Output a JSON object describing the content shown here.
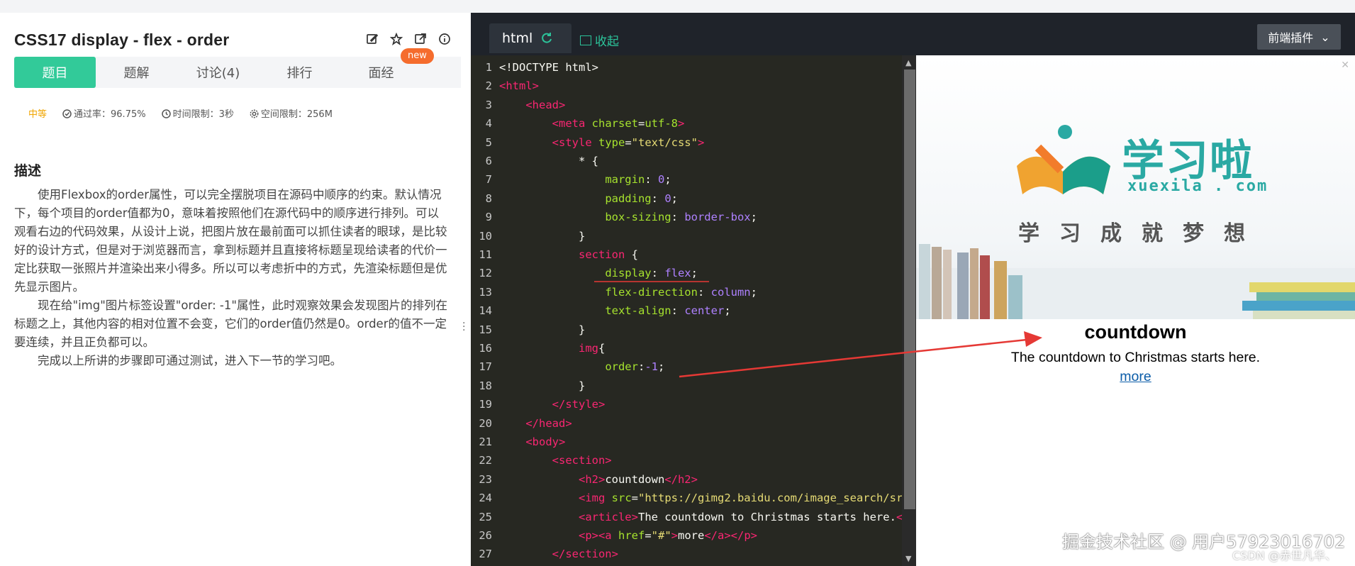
{
  "problem": {
    "title": "CSS17  display - flex - order",
    "tabs": [
      {
        "label": "题目"
      },
      {
        "label": "题解"
      },
      {
        "label": "讨论(4)"
      },
      {
        "label": "排行"
      },
      {
        "label": "面经"
      }
    ],
    "new_badge": "new",
    "meta": {
      "level": "中等",
      "pass_rate": "通过率：96.75%",
      "time_limit": "时间限制：3秒",
      "space_limit": "空间限制：256M"
    },
    "desc_heading": "描述",
    "desc_paragraphs": [
      "使用Flexbox的order属性，可以完全摆脱项目在源码中顺序的约束。默认情况下，每个项目的order值都为0，意味着按照他们在源代码中的顺序进行排列。可以观看右边的代码效果，从设计上说，把图片放在最前面可以抓住读者的眼球，是比较好的设计方式，但是对于浏览器而言，拿到标题并且直接将标题呈现给读者的代价一定比获取一张照片并渲染出来小得多。所以可以考虑折中的方式，先渲染标题但是优先显示图片。",
      "现在给\"img\"图片标签设置\"order: -1\"属性，此时观察效果会发现图片的排列在标题之上，其他内容的相对位置不会变，它们的order值仍然是0。order的值不一定要连续，并且正负都可以。",
      "完成以上所讲的步骤即可通过测试，进入下一节的学习吧。"
    ]
  },
  "editor": {
    "tab_label": "html",
    "collapse_label": "收起",
    "plugin_label": "前端插件",
    "lines": [
      {
        "n": "1",
        "parts": [
          [
            "plain",
            "<!DOCTYPE html>"
          ]
        ]
      },
      {
        "n": "2",
        "parts": [
          [
            "tag",
            "<html>"
          ]
        ]
      },
      {
        "n": "3",
        "parts": [
          [
            "plain",
            "    "
          ],
          [
            "tag",
            "<head>"
          ]
        ]
      },
      {
        "n": "4",
        "parts": [
          [
            "plain",
            "        "
          ],
          [
            "tag",
            "<meta "
          ],
          [
            "attr",
            "charset"
          ],
          [
            "plain",
            "="
          ],
          [
            "attr",
            "utf-8"
          ],
          [
            "tag",
            ">"
          ]
        ]
      },
      {
        "n": "5",
        "parts": [
          [
            "plain",
            "        "
          ],
          [
            "tag",
            "<style "
          ],
          [
            "attr",
            "type"
          ],
          [
            "plain",
            "="
          ],
          [
            "str",
            "\"text/css\""
          ],
          [
            "tag",
            ">"
          ]
        ]
      },
      {
        "n": "6",
        "parts": [
          [
            "plain",
            "            * {"
          ]
        ]
      },
      {
        "n": "7",
        "parts": [
          [
            "plain",
            "                "
          ],
          [
            "attr",
            "margin"
          ],
          [
            "plain",
            ": "
          ],
          [
            "val",
            "0"
          ],
          [
            "plain",
            ";"
          ]
        ]
      },
      {
        "n": "8",
        "parts": [
          [
            "plain",
            "                "
          ],
          [
            "attr",
            "padding"
          ],
          [
            "plain",
            ": "
          ],
          [
            "val",
            "0"
          ],
          [
            "plain",
            ";"
          ]
        ]
      },
      {
        "n": "9",
        "parts": [
          [
            "plain",
            "                "
          ],
          [
            "attr",
            "box-sizing"
          ],
          [
            "plain",
            ": "
          ],
          [
            "val",
            "border-box"
          ],
          [
            "plain",
            ";"
          ]
        ]
      },
      {
        "n": "10",
        "parts": [
          [
            "plain",
            "            }"
          ]
        ]
      },
      {
        "n": "11",
        "parts": [
          [
            "plain",
            "            "
          ],
          [
            "tag",
            "section"
          ],
          [
            "plain",
            " {"
          ]
        ]
      },
      {
        "n": "12",
        "parts": [
          [
            "plain",
            "                "
          ],
          [
            "attr",
            "display"
          ],
          [
            "plain",
            ": "
          ],
          [
            "val",
            "flex"
          ],
          [
            "plain",
            ";"
          ]
        ]
      },
      {
        "n": "13",
        "parts": [
          [
            "plain",
            "                "
          ],
          [
            "attr",
            "flex-direction"
          ],
          [
            "plain",
            ": "
          ],
          [
            "val",
            "column"
          ],
          [
            "plain",
            ";"
          ]
        ]
      },
      {
        "n": "14",
        "parts": [
          [
            "plain",
            "                "
          ],
          [
            "attr",
            "text-align"
          ],
          [
            "plain",
            ": "
          ],
          [
            "val",
            "center"
          ],
          [
            "plain",
            ";"
          ]
        ]
      },
      {
        "n": "15",
        "parts": [
          [
            "plain",
            "            }"
          ]
        ]
      },
      {
        "n": "16",
        "parts": [
          [
            "plain",
            "            "
          ],
          [
            "tag",
            "img"
          ],
          [
            "plain",
            "{"
          ]
        ]
      },
      {
        "n": "17",
        "parts": [
          [
            "plain",
            "                "
          ],
          [
            "attr",
            "order"
          ],
          [
            "plain",
            ":"
          ],
          [
            "val",
            "-1"
          ],
          [
            "plain",
            ";"
          ]
        ]
      },
      {
        "n": "18",
        "parts": [
          [
            "plain",
            "            }"
          ]
        ]
      },
      {
        "n": "19",
        "parts": [
          [
            "plain",
            "        "
          ],
          [
            "tag",
            "</style>"
          ]
        ]
      },
      {
        "n": "20",
        "parts": [
          [
            "plain",
            "    "
          ],
          [
            "tag",
            "</head>"
          ]
        ]
      },
      {
        "n": "21",
        "parts": [
          [
            "plain",
            "    "
          ],
          [
            "tag",
            "<body>"
          ]
        ]
      },
      {
        "n": "22",
        "parts": [
          [
            "plain",
            "        "
          ],
          [
            "tag",
            "<section>"
          ]
        ]
      },
      {
        "n": "23",
        "parts": [
          [
            "plain",
            "            "
          ],
          [
            "tag",
            "<h2>"
          ],
          [
            "plain",
            "countdown"
          ],
          [
            "tag",
            "</h2>"
          ]
        ]
      },
      {
        "n": "24",
        "parts": [
          [
            "plain",
            "            "
          ],
          [
            "tag",
            "<img "
          ],
          [
            "attr",
            "src"
          ],
          [
            "plain",
            "="
          ],
          [
            "str",
            "\"https://gimg2.baidu.com/image_search/sr"
          ]
        ]
      },
      {
        "n": "25",
        "parts": [
          [
            "plain",
            "            "
          ],
          [
            "tag",
            "<article>"
          ],
          [
            "plain",
            "The countdown to Christmas starts here."
          ],
          [
            "tag",
            "<"
          ]
        ]
      },
      {
        "n": "26",
        "parts": [
          [
            "plain",
            "            "
          ],
          [
            "tag",
            "<p><a "
          ],
          [
            "attr",
            "href"
          ],
          [
            "plain",
            "="
          ],
          [
            "str",
            "\"#\""
          ],
          [
            "tag",
            ">"
          ],
          [
            "plain",
            "more"
          ],
          [
            "tag",
            "</a></p>"
          ]
        ]
      },
      {
        "n": "27",
        "parts": [
          [
            "plain",
            "        "
          ],
          [
            "tag",
            "</section>"
          ]
        ]
      }
    ]
  },
  "preview": {
    "logo_cn": "学习啦",
    "logo_en": "xuexila . com",
    "slogan": "学习成就梦想",
    "h2": "countdown",
    "article": "The countdown to Christmas starts here.",
    "link": "more",
    "close": "✕"
  },
  "watermarks": {
    "main": "掘金技术社区 @ 用户57923016702",
    "csdn": "CSDN @赤世凡华、"
  },
  "colors": {
    "accent": "#32ca99",
    "badge": "#f56c2d",
    "annotation": "#e53935"
  }
}
